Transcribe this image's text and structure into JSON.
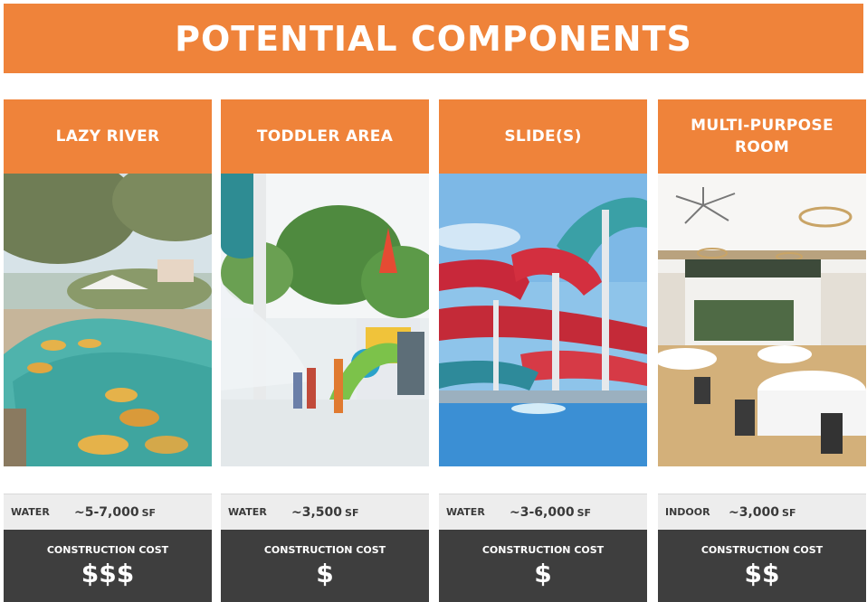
{
  "title": "POTENTIAL COMPONENTS",
  "cards": [
    {
      "name": "LAZY RIVER",
      "type": "WATER",
      "size": "~5-7,000",
      "unit": "SF",
      "cost_label": "CONSTRUCTION COST",
      "cost": "$$$"
    },
    {
      "name": "TODDLER AREA",
      "type": "WATER",
      "size": "~3,500",
      "unit": "SF",
      "cost_label": "CONSTRUCTION COST",
      "cost": "$"
    },
    {
      "name": "SLIDE(S)",
      "type": "WATER",
      "size": "~3-6,000",
      "unit": "SF",
      "cost_label": "CONSTRUCTION COST",
      "cost": "$"
    },
    {
      "name": "MULTI-PURPOSE ROOM",
      "type": "INDOOR",
      "size": "~3,000",
      "unit": "SF",
      "cost_label": "CONSTRUCTION COST",
      "cost": "$$"
    }
  ],
  "colors": {
    "accent": "#EF833A",
    "cost_bg": "#3E3E3E",
    "info_bg": "#EDEDED"
  }
}
